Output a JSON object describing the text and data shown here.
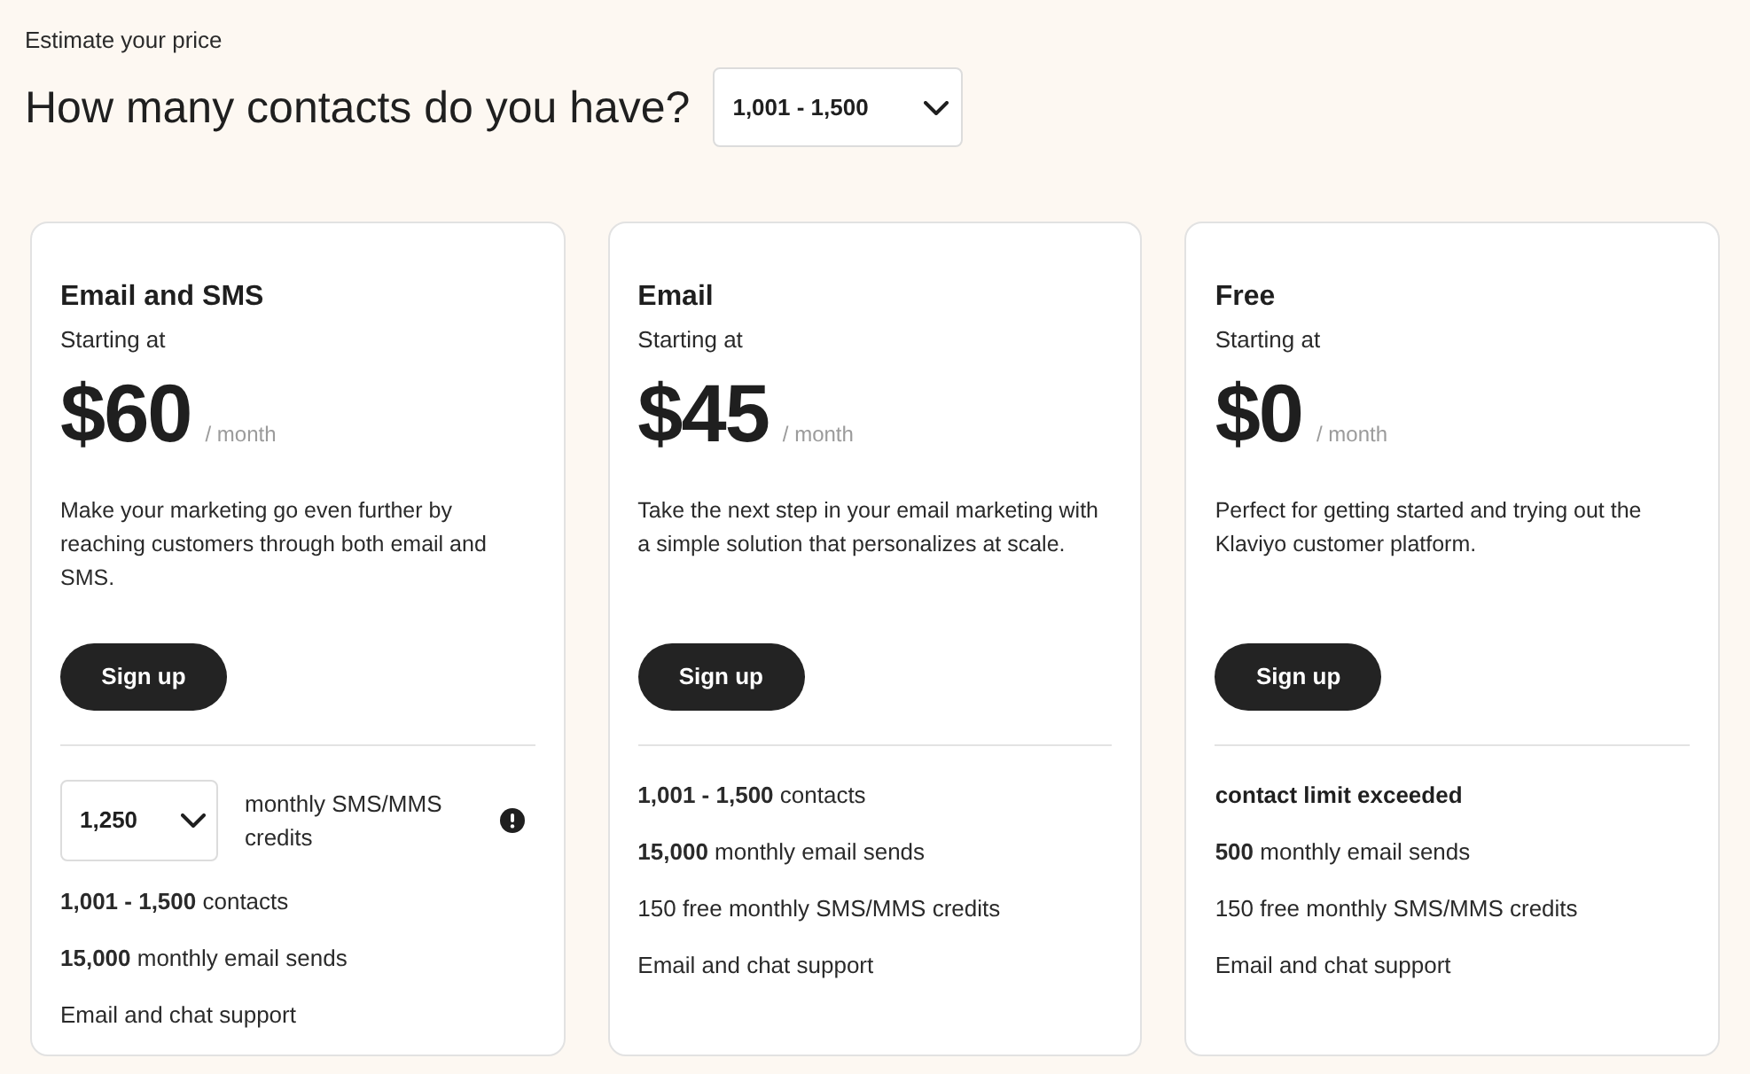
{
  "estimator": {
    "eyebrow": "Estimate your price",
    "question": "How many contacts do you have?",
    "contacts_select": {
      "value": "1,001 - 1,500"
    }
  },
  "plans": [
    {
      "name": "Email and SMS",
      "starting_label": "Starting at",
      "price": "$60",
      "period": "/ month",
      "description": "Make your marketing go even further by reaching customers through both email and SMS.",
      "button": "Sign up",
      "sms_credits": {
        "value": "1,250",
        "label": "monthly SMS/MMS credits"
      },
      "features": [
        {
          "kind": "feature",
          "text": "**1,001 - 1,500** contacts"
        },
        {
          "kind": "feature",
          "text": "**15,000** monthly email sends"
        },
        {
          "kind": "feature",
          "text": "Email and chat support"
        }
      ]
    },
    {
      "name": "Email",
      "starting_label": "Starting at",
      "price": "$45",
      "period": "/ month",
      "description": "Take the next step in your email marketing with a simple solution that personalizes at scale.",
      "button": "Sign up",
      "features": [
        {
          "kind": "feature",
          "text": "**1,001 - 1,500** contacts"
        },
        {
          "kind": "feature",
          "text": "**15,000** monthly email sends"
        },
        {
          "kind": "feature",
          "text": "150 free monthly SMS/MMS credits"
        },
        {
          "kind": "feature",
          "text": "Email and chat support"
        }
      ]
    },
    {
      "name": "Free",
      "starting_label": "Starting at",
      "price": "$0",
      "period": "/ month",
      "description": "Perfect for getting started and trying out the Klaviyo customer platform.",
      "button": "Sign up",
      "features": [
        {
          "kind": "limit",
          "text": "contact limit exceeded"
        },
        {
          "kind": "feature",
          "text": "**500** monthly email sends"
        },
        {
          "kind": "feature",
          "text": "150 free monthly SMS/MMS credits"
        },
        {
          "kind": "feature",
          "text": "Email and chat support"
        }
      ]
    }
  ]
}
